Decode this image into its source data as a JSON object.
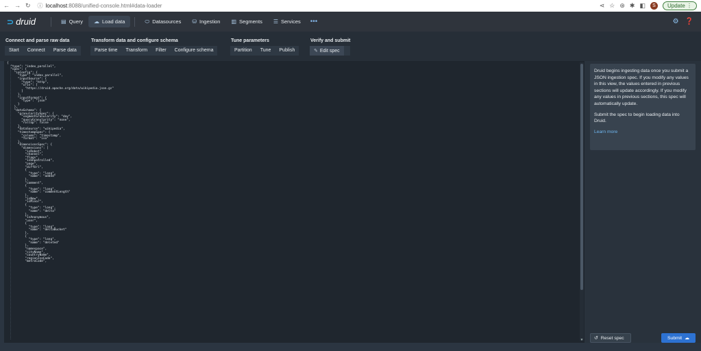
{
  "browser": {
    "back": "←",
    "forward": "→",
    "reload": "↻",
    "url_host": "localhost",
    "url_path": ":8088/unified-console.html#data-loader",
    "avatar": "S",
    "update_label": "Update"
  },
  "topbar": {
    "logo": "druid",
    "tabs": [
      {
        "label": "Query",
        "icon": "query-icon",
        "glyph": "▤"
      },
      {
        "label": "Load data",
        "icon": "cloud-upload-icon",
        "glyph": "☁"
      },
      {
        "label": "Datasources",
        "icon": "datasource-icon",
        "glyph": "⬭"
      },
      {
        "label": "Ingestion",
        "icon": "ingestion-icon",
        "glyph": "⛁"
      },
      {
        "label": "Segments",
        "icon": "segments-icon",
        "glyph": "▥"
      },
      {
        "label": "Services",
        "icon": "services-icon",
        "glyph": "☰"
      }
    ],
    "more": "•••"
  },
  "steps": {
    "groups": [
      {
        "title": "Connect and parse raw data",
        "buttons": [
          "Start",
          "Connect",
          "Parse data"
        ]
      },
      {
        "title": "Transform data and configure schema",
        "buttons": [
          "Parse time",
          "Transform",
          "Filter",
          "Configure schema"
        ]
      },
      {
        "title": "Tune parameters",
        "buttons": [
          "Partition",
          "Tune",
          "Publish"
        ]
      },
      {
        "title": "Verify and submit",
        "buttons": [
          "Edit spec"
        ]
      }
    ]
  },
  "editor": {
    "spec": "{\n  \"type\": \"index_parallel\",\n  \"spec\": {\n    \"ioConfig\": {\n      \"type\": \"index_parallel\",\n      \"inputSource\": {\n        \"type\": \"http\",\n        \"uris\": [\n          \"https://druid.apache.org/data/wikipedia.json.gz\"\n        ]\n      },\n      \"inputFormat\": {\n        \"type\": \"json\"\n      }\n    },\n    \"dataSchema\": {\n      \"granularitySpec\": {\n        \"segmentGranularity\": \"day\",\n        \"queryGranularity\": \"none\",\n        \"rollup\": false\n      },\n      \"dataSource\": \"wikipedia\",\n      \"timestampSpec\": {\n        \"column\": \"timestamp\",\n        \"format\": \"iso\"\n      },\n      \"dimensionsSpec\": {\n        \"dimensions\": [\n          \"isRobot\",\n          \"channel\",\n          \"flags\",\n          \"isUnpatrolled\",\n          \"page\",\n          \"diffUrl\",\n          {\n            \"type\": \"long\",\n            \"name\": \"added\"\n          },\n          \"comment\",\n          {\n            \"type\": \"long\",\n            \"name\": \"commentLength\"\n          },\n          \"isNew\",\n          \"isMinor\",\n          {\n            \"type\": \"long\",\n            \"name\": \"delta\"\n          },\n          \"isAnonymous\",\n          \"user\",\n          {\n            \"type\": \"long\",\n            \"name\": \"deltaBucket\"\n          },\n          {\n            \"type\": \"long\",\n            \"name\": \"deleted\"\n          },\n          \"namespace\",\n          \"cityName\",\n          \"countryName\",\n          \"regionIsoCode\",\n          \"metroCode\","
  },
  "side": {
    "info_p1": "Druid begins ingesting data once you submit a JSON ingestion spec. If you modify any values in this view, the values entered in previous sections will update accordingly. If you modify any values in previous sections, this spec will automatically update.",
    "info_p2": "Submit the spec to begin loading data into Druid.",
    "learn_more": "Learn more",
    "reset_label": "Reset spec",
    "submit_label": "Submit"
  },
  "colors": {
    "accent": "#2d72d2",
    "background": "#2b3541",
    "topbar": "#2f343c"
  }
}
